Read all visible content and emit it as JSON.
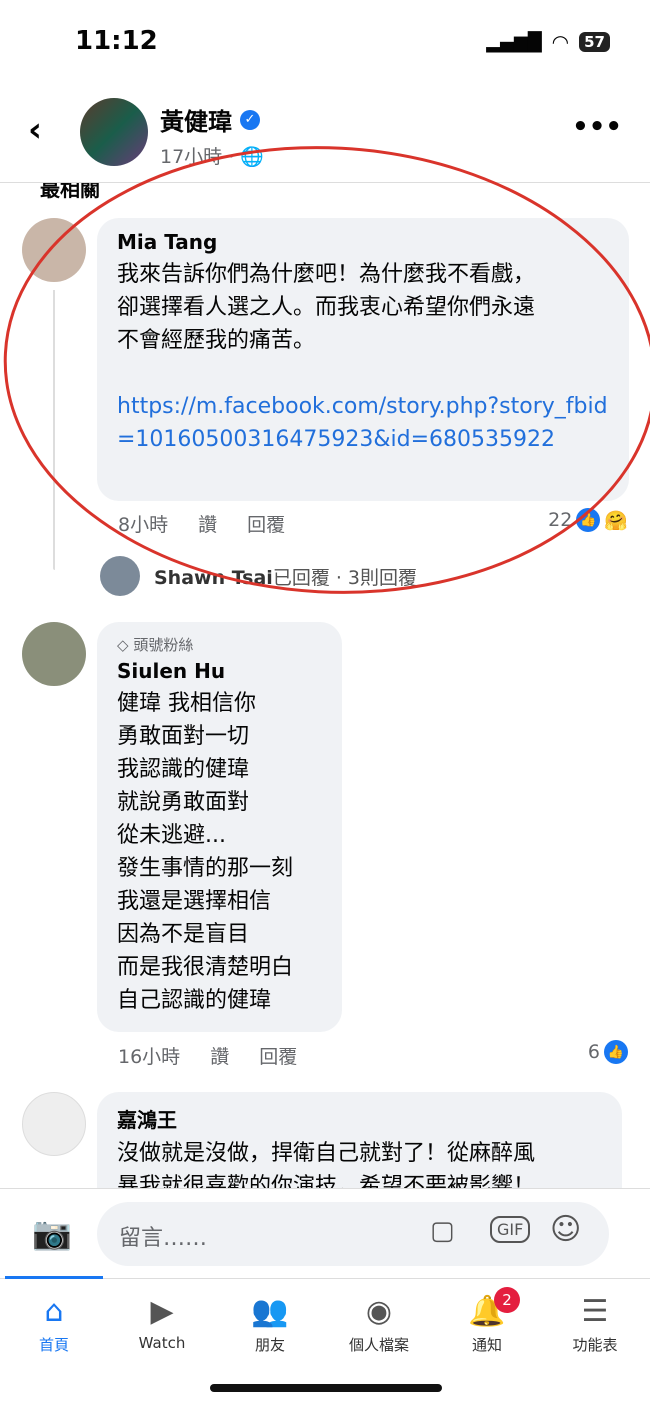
{
  "status": {
    "time": "11:12",
    "battery": "57"
  },
  "header": {
    "name": "黃健瑋",
    "time": "17小時 ·",
    "sort_label": "最相關"
  },
  "comments": [
    {
      "name": "Mia Tang",
      "text": "我來告訴你們為什麼吧！為什麼我不看戲，\n卻選擇看人選之人。而我衷心希望你們永遠\n不會經歷我的痛苦。",
      "link": "https://m.facebook.com/story.php?story_fbid=10160500316475923&id=680535922",
      "time": "8小時",
      "like": "讚",
      "reply": "回覆",
      "reactions": "22",
      "reply_summary": {
        "name": "Shawn Tsai",
        "text": "已回覆 · 3則回覆"
      }
    },
    {
      "badge": "頭號粉絲",
      "name": "Siulen Hu",
      "text": "健瑋 我相信你\n勇敢面對一切\n我認識的健瑋\n就說勇敢面對\n從未逃避...\n發生事情的那一刻\n我還是選擇相信\n因為不是盲目\n而是我很清楚明白\n自己認識的健瑋",
      "time": "16小時",
      "like": "讚",
      "reply": "回覆",
      "reactions": "6"
    },
    {
      "name": "嘉鴻王",
      "text": "沒做就是沒做，捍衛自己就對了！從麻醉風\n暴我就很喜歡的你演技，希望不要被影響！"
    }
  ],
  "composer": {
    "placeholder": "留言……",
    "gif": "GIF"
  },
  "nav": [
    {
      "label": "首頁",
      "icon": "home-icon"
    },
    {
      "label": "Watch",
      "icon": "watch-icon"
    },
    {
      "label": "朋友",
      "icon": "friends-icon"
    },
    {
      "label": "個人檔案",
      "icon": "profile-icon"
    },
    {
      "label": "通知",
      "icon": "bell-icon",
      "badge": "2"
    },
    {
      "label": "功能表",
      "icon": "menu-icon"
    }
  ],
  "colors": {
    "accent": "#1877f2",
    "annotation": "#d9342b"
  }
}
